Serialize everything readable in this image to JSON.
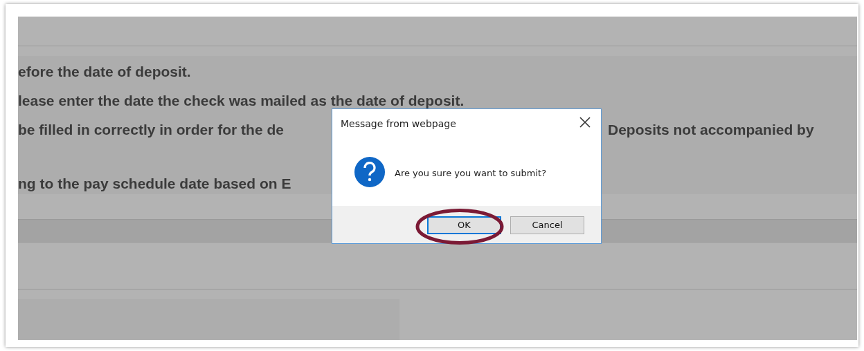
{
  "page": {
    "lines": [
      {
        "left": "efore the date of deposit."
      },
      {
        "left": "lease enter the date the check was mailed as the date of deposit."
      },
      {
        "left": "be filled in correctly in order for the de",
        "right": "Deposits not accompanied by"
      },
      {
        "left": "ng to the pay schedule date based on E"
      }
    ]
  },
  "dialog": {
    "title": "Message from webpage",
    "message": "Are you sure you want to submit?",
    "buttons": [
      {
        "label": "OK",
        "selected": true
      },
      {
        "label": "Cancel",
        "selected": false
      }
    ]
  }
}
